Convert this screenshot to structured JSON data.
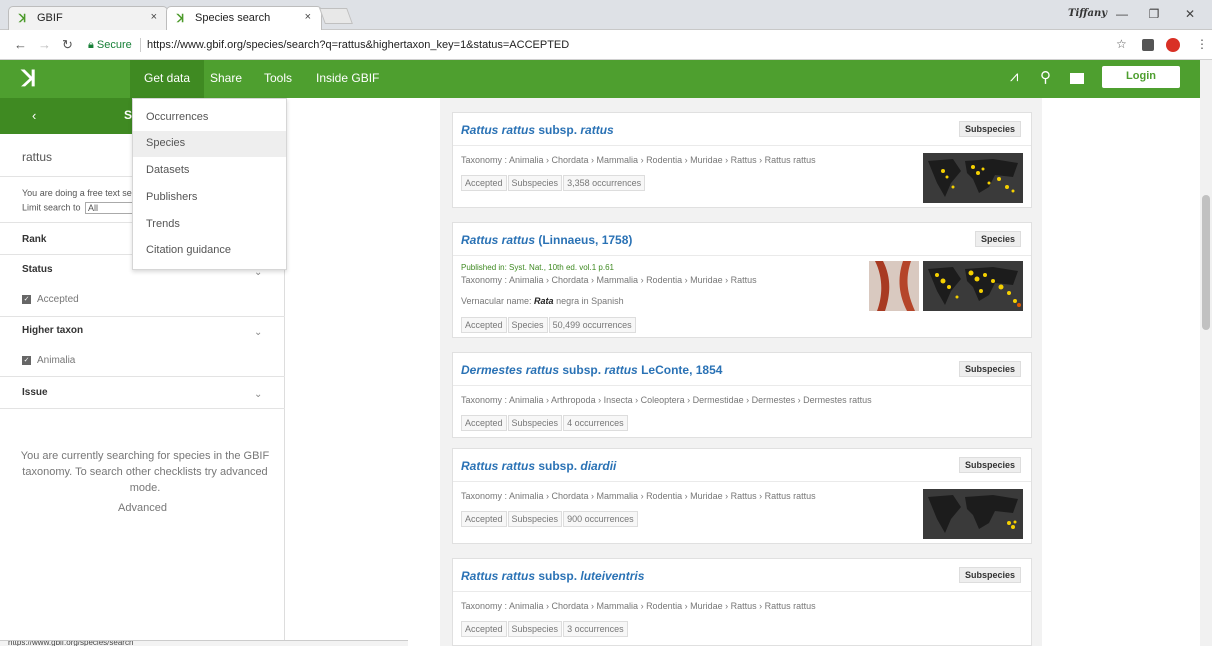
{
  "browser": {
    "tabs": [
      {
        "label": "GBIF",
        "close": "×"
      },
      {
        "label": "Species search",
        "close": "×"
      }
    ],
    "profile_name": "Tiffany",
    "window_controls": {
      "minimize": "—",
      "restore": "❐",
      "close": "✕"
    },
    "secure_label": "Secure",
    "url": "https://www.gbif.org/species/search?q=rattus&highertaxon_key=1&status=ACCEPTED",
    "status_url": "https://www.gbif.org/species/search"
  },
  "header": {
    "nav": [
      "Get data",
      "Share",
      "Tools",
      "Inside GBIF"
    ],
    "login_label": "Login"
  },
  "dropdown": {
    "items": [
      "Occurrences",
      "Species",
      "Datasets",
      "Publishers",
      "Trends",
      "Citation guidance"
    ]
  },
  "sidebar": {
    "header_back": "‹",
    "header_partial": "S",
    "search_value": "rattus",
    "free_text_note": "You are doing a free text se",
    "limit_label": "Limit search to",
    "limit_value": "All",
    "facets": {
      "rank": "Rank",
      "status": "Status",
      "status_checked": "Accepted",
      "higher_taxon": "Higher taxon",
      "higher_taxon_checked": "Animalia",
      "issue": "Issue"
    },
    "info_text": "You are currently searching for species in the GBIF taxonomy. To search other checklists try advanced mode.",
    "advanced_label": "Advanced"
  },
  "results": [
    {
      "title_italic": "Rattus rattus",
      "title_plain": " subsp. ",
      "title_italic2": "rattus",
      "rank": "Subspecies",
      "taxonomy": "Taxonomy : Animalia › Chordata › Mammalia › Rodentia › Muridae › Rattus › Rattus rattus",
      "tags": [
        "Accepted",
        "Subspecies",
        "3,358 occurrences"
      ]
    },
    {
      "title_italic": "Rattus rattus",
      "title_plain": " (Linnaeus, 1758)",
      "title_italic2": "",
      "rank": "Species",
      "published": "Published in: Syst. Nat., 10th ed. vol.1 p.61",
      "taxonomy": "Taxonomy : Animalia › Chordata › Mammalia › Rodentia › Muridae › Rattus",
      "vernacular_label": "Vernacular name: ",
      "vernacular_name": "Rata",
      "vernacular_rest": " negra in Spanish",
      "tags": [
        "Accepted",
        "Species",
        "50,499 occurrences"
      ]
    },
    {
      "title_italic": "Dermestes rattus",
      "title_plain": " subsp. ",
      "title_italic2": "rattus",
      "title_tail": " LeConte, 1854",
      "rank": "Subspecies",
      "taxonomy": "Taxonomy : Animalia › Arthropoda › Insecta › Coleoptera › Dermestidae › Dermestes › Dermestes rattus",
      "tags": [
        "Accepted",
        "Subspecies",
        "4 occurrences"
      ]
    },
    {
      "title_italic": "Rattus rattus",
      "title_plain": " subsp. ",
      "title_italic2": "diardii",
      "rank": "Subspecies",
      "taxonomy": "Taxonomy : Animalia › Chordata › Mammalia › Rodentia › Muridae › Rattus › Rattus rattus",
      "tags": [
        "Accepted",
        "Subspecies",
        "900 occurrences"
      ]
    },
    {
      "title_italic": "Rattus rattus",
      "title_plain": " subsp. ",
      "title_italic2": "luteiventris",
      "rank": "Subspecies",
      "taxonomy": "Taxonomy : Animalia › Chordata › Mammalia › Rodentia › Muridae › Rattus › Rattus rattus",
      "tags": [
        "Accepted",
        "Subspecies",
        "3 occurrences"
      ]
    }
  ],
  "colors": {
    "brand_green": "#4e9f2f",
    "dark_green": "#3f8a22",
    "link_blue": "#2a72b5",
    "map_bg": "#3a3a3a",
    "occurrence_dot": "#f5d000"
  },
  "icons": [
    "gbif-logo-icon",
    "activity-icon",
    "search-icon",
    "feedback-icon",
    "star-icon",
    "lock-icon",
    "back-icon",
    "forward-icon",
    "reload-icon",
    "chevron-down-icon"
  ]
}
